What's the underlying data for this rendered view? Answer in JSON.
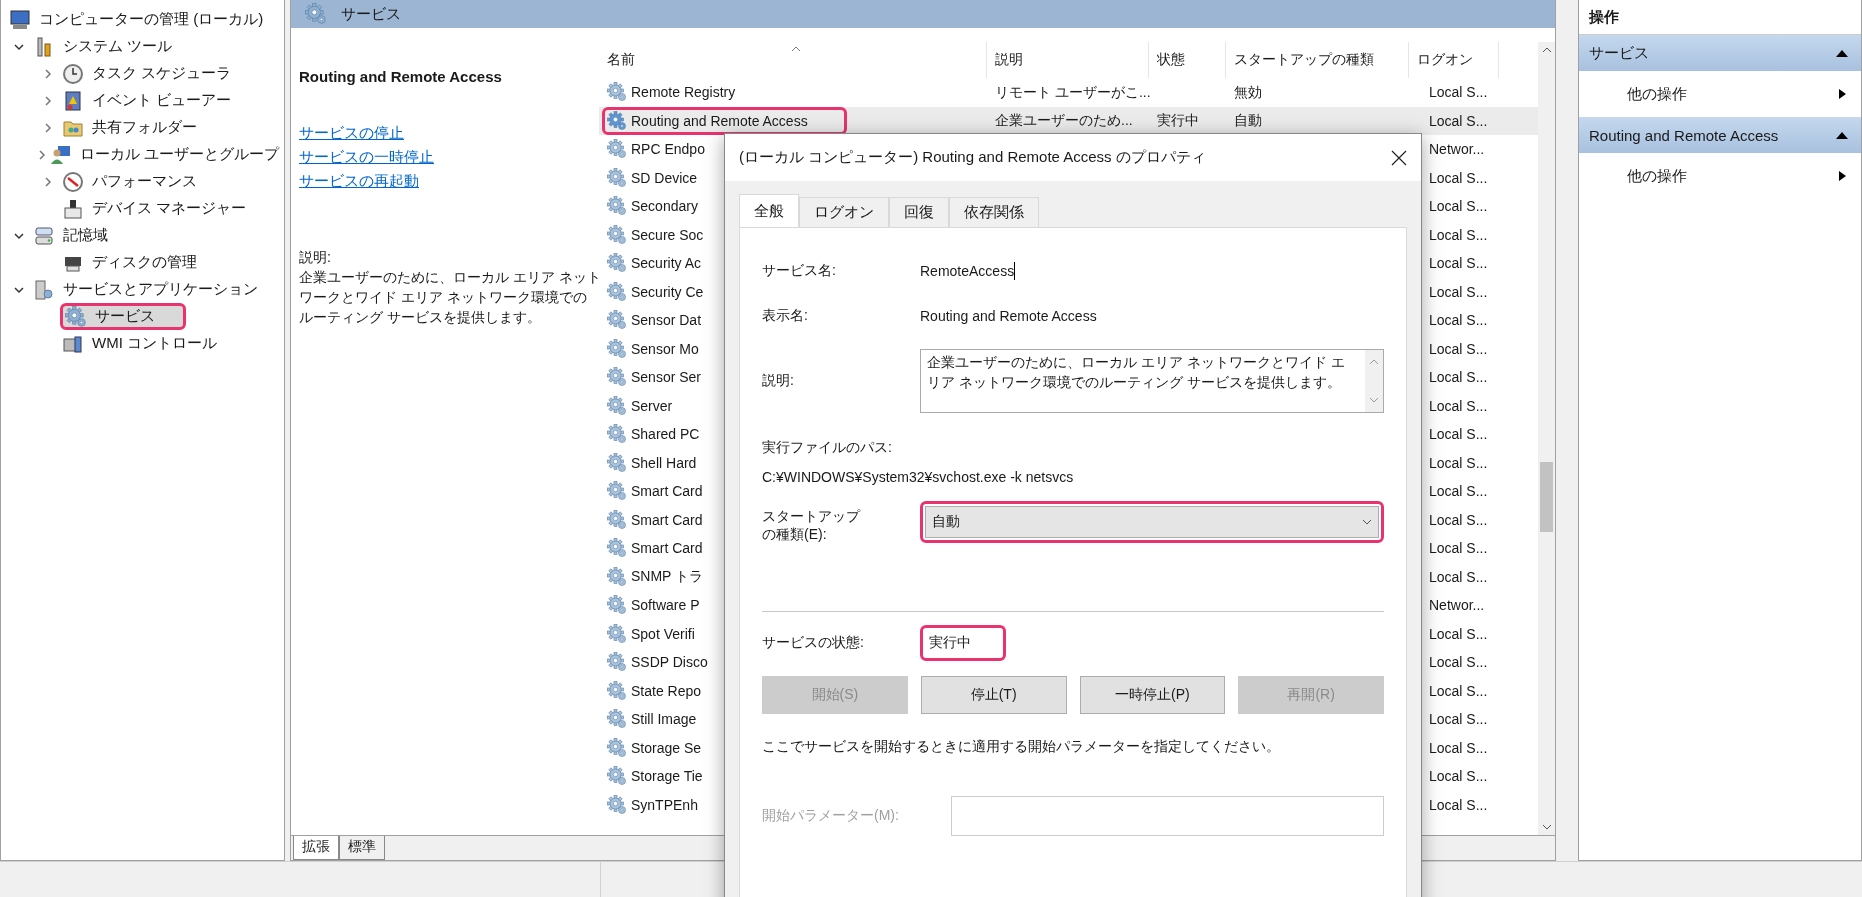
{
  "tree": {
    "label": "コンピューターの管理 (ローカル)",
    "selected": false,
    "children": [
      {
        "label": "システム ツール",
        "expanded": true,
        "selected": false,
        "children": [
          {
            "label": "タスク スケジューラ",
            "expanded": false,
            "selected": false
          },
          {
            "label": "イベント ビューアー",
            "expanded": false,
            "selected": false
          },
          {
            "label": "共有フォルダー",
            "expanded": false,
            "selected": false
          },
          {
            "label": "ローカル ユーザーとグループ",
            "expanded": false,
            "selected": false
          },
          {
            "label": "パフォーマンス",
            "expanded": false,
            "selected": false
          },
          {
            "label": "デバイス マネージャー",
            "selected": false
          }
        ]
      },
      {
        "label": "記憶域",
        "expanded": true,
        "selected": false,
        "children": [
          {
            "label": "ディスクの管理",
            "selected": false
          }
        ]
      },
      {
        "label": "サービスとアプリケーション",
        "expanded": true,
        "selected": false,
        "children": [
          {
            "label": "サービス",
            "selected": true,
            "highlighted": true
          },
          {
            "label": "WMI コントロール",
            "selected": false
          }
        ]
      }
    ]
  },
  "pane_title": "サービス",
  "detail": {
    "title": "Routing and Remote Access",
    "links": [
      "サービスの停止",
      "サービスの一時停止",
      "サービスの再起動"
    ],
    "description_label": "説明:",
    "description_lines": [
      "企業ユーザーのために、ローカル エリア ネット",
      "ワークとワイド エリア ネットワーク環境での",
      "ルーティング サービスを提供します。"
    ]
  },
  "list": {
    "columns": [
      "名前",
      "説明",
      "状態",
      "スタートアップの種類",
      "ログオン"
    ],
    "rows": [
      {
        "name": "Remote Registry",
        "description": "リモート ユーザーがこ...",
        "startup": "無効",
        "logon": "Local S...",
        "selected": false
      },
      {
        "name": "Routing and Remote Access",
        "description": "企業ユーザーのため...",
        "status": "実行中",
        "startup": "自動",
        "logon": "Local S...",
        "selected": true,
        "highlighted": true
      },
      {
        "name": "RPC Endpo",
        "logon": "Networ...",
        "selected": false
      },
      {
        "name": "SD Device",
        "logon": "Local S...",
        "selected": false
      },
      {
        "name": "Secondary",
        "logon": "Local S...",
        "selected": false
      },
      {
        "name": "Secure Soc",
        "logon": "Local S...",
        "selected": false
      },
      {
        "name": "Security Ac",
        "logon": "Local S...",
        "selected": false
      },
      {
        "name": "Security Ce",
        "logon": "Local S...",
        "selected": false
      },
      {
        "name": "Sensor Dat",
        "logon": "Local S...",
        "selected": false
      },
      {
        "name": "Sensor Mo",
        "logon": "Local S...",
        "selected": false
      },
      {
        "name": "Sensor Ser",
        "logon": "Local S...",
        "selected": false
      },
      {
        "name": "Server",
        "logon": "Local S...",
        "selected": false
      },
      {
        "name": "Shared PC",
        "logon": "Local S...",
        "selected": false
      },
      {
        "name": "Shell Hard",
        "logon": "Local S...",
        "selected": false
      },
      {
        "name": "Smart Card",
        "logon": "Local S...",
        "selected": false
      },
      {
        "name": "Smart Card",
        "logon": "Local S...",
        "selected": false
      },
      {
        "name": "Smart Card",
        "logon": "Local S...",
        "selected": false
      },
      {
        "name": "SNMP トラ",
        "logon": "Local S...",
        "selected": false
      },
      {
        "name": "Software P",
        "logon": "Networ...",
        "selected": false
      },
      {
        "name": "Spot Verifi",
        "logon": "Local S...",
        "selected": false
      },
      {
        "name": "SSDP Disco",
        "logon": "Local S...",
        "selected": false
      },
      {
        "name": "State Repo",
        "logon": "Local S...",
        "selected": false
      },
      {
        "name": "Still Image",
        "logon": "Local S...",
        "selected": false
      },
      {
        "name": "Storage Se",
        "logon": "Local S...",
        "selected": false
      },
      {
        "name": "Storage Tie",
        "logon": "Local S...",
        "selected": false
      },
      {
        "name": "SynTPEnh",
        "logon": "Local S...",
        "selected": false
      }
    ]
  },
  "view_tabs": [
    {
      "label": "拡張",
      "selected": true
    },
    {
      "label": "標準",
      "selected": false
    }
  ],
  "actions": {
    "title": "操作",
    "sections": [
      {
        "title": "サービス",
        "expanded": true,
        "items": [
          "他の操作"
        ]
      },
      {
        "title": "Routing and Remote Access",
        "expanded": true,
        "items": [
          "他の操作"
        ]
      }
    ]
  },
  "dialog": {
    "title": "(ローカル コンピューター) Routing and Remote Access のプロパティ",
    "tabs": [
      {
        "label": "全般",
        "selected": true
      },
      {
        "label": "ログオン",
        "selected": false
      },
      {
        "label": "回復",
        "selected": false
      },
      {
        "label": "依存関係",
        "selected": false
      }
    ],
    "service_name_label": "サービス名:",
    "service_name": "RemoteAccess",
    "display_name_label": "表示名:",
    "display_name": "Routing and Remote Access",
    "description_label": "説明:",
    "description": "企業ユーザーのために、ローカル エリア ネットワークとワイド エリア ネットワーク環境でのルーティング サービスを提供します。",
    "path_label": "実行ファイルのパス:",
    "path": "C:¥WINDOWS¥System32¥svchost.exe -k netsvcs",
    "startup_label": "スタートアップの種類(E):",
    "startup": {
      "value": "自動",
      "highlighted": true
    },
    "status_label": "サービスの状態:",
    "status": {
      "value": "実行中",
      "highlighted": true
    },
    "buttons": [
      {
        "label": "開始(S)",
        "disabled": true
      },
      {
        "label": "停止(T)",
        "disabled": false
      },
      {
        "label": "一時停止(P)",
        "disabled": false
      },
      {
        "label": "再開(R)",
        "disabled": true
      }
    ],
    "hint": "ここでサービスを開始するときに適用する開始パラメーターを指定してください。",
    "param_label": "開始パラメーター(M):",
    "param_disabled": true
  }
}
